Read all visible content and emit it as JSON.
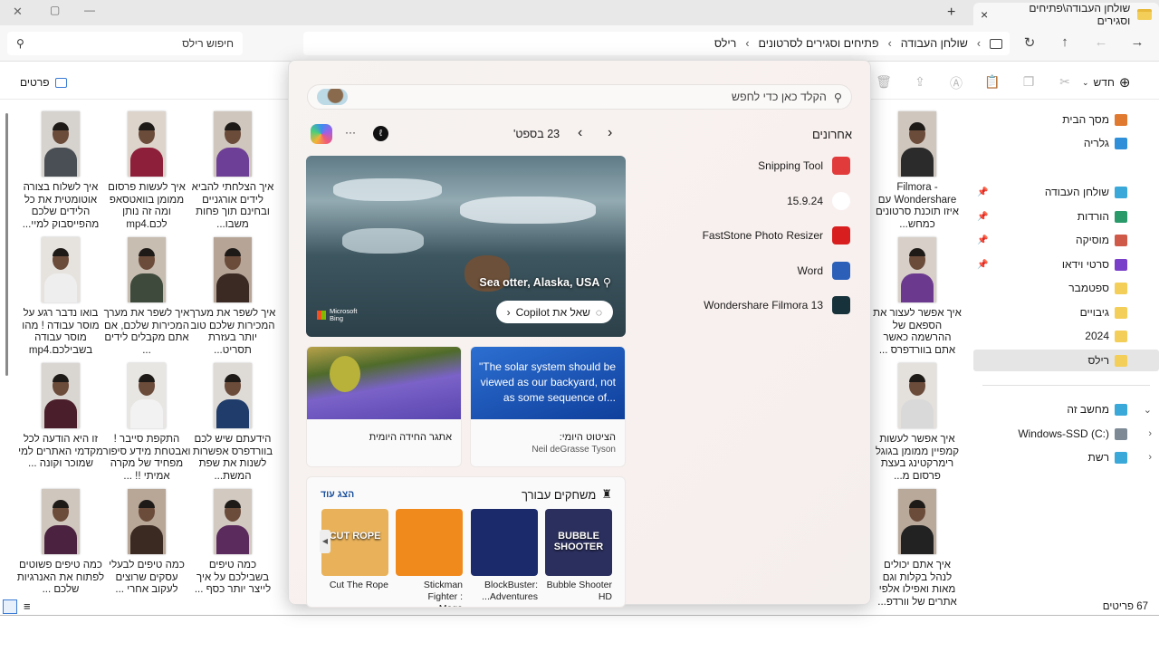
{
  "window": {
    "tab_title": "שולחן העבודה\\פתיחים וסגירים",
    "new_tab": "+",
    "close_tab": "×",
    "minimize": "—",
    "maximize": "▢",
    "close": "✕"
  },
  "address": {
    "crumbs": [
      "שולחן העבודה",
      "פתיחים וסגירים לסרטונים",
      "רילס"
    ],
    "search_placeholder": "חיפוש רילס"
  },
  "toolbar": {
    "new_label": "חדש",
    "details_label": "פרטים"
  },
  "files": [
    {
      "caption": "Filmora - Wondershare עם איזו תוכנת סרטונים כמחש...",
      "shirt": "#2b2b2b",
      "bg": "#cfc7be"
    },
    {
      "caption": "איך אפשר לעצור את הספאם של ההרשמה כאשר אתם בוורדפרס ...",
      "shirt": "#6b3a8f",
      "bg": "#d8d0c8"
    },
    {
      "caption": "איך אפשר לעשות קמפיין ממומן בגוגל רימרקטינג בעצת פרסום מ...",
      "shirt": "#d9d9d9",
      "bg": "#e4e1dd"
    },
    {
      "caption": "איך אתם יכולים לנהל בקלות וגם מאות ואפילו אלפי אתרים של וורדפ...",
      "shirt": "#222",
      "bg": "#b9a99a"
    },
    {
      "caption": "איך הצלחתי להביא לידים אורגניים ובחינם תוך פחות משבו...",
      "shirt": "#6e3f96",
      "bg": "#cfc6bd"
    },
    {
      "caption": "איך לעשות פרסום ממומן בוואטסאפ ומה זה נותן לכם.mp4",
      "shirt": "#8e1f3a",
      "bg": "#ddd5cc"
    },
    {
      "caption": "איך לשלוח בצורה אוטומטית את כל הלידים שלכם מהפייסבוק למיי...",
      "shirt": "#4a4f55",
      "bg": "#d6d3cf"
    },
    {
      "caption": "איך לשפר את מערך המכירות שלכם טוב יותר בעזרת תסריט...",
      "shirt": "#3b2a24",
      "bg": "#b6a597"
    },
    {
      "caption": "איך לשפר את מערך המכירות שלכם, אם אתם מקבלים לידים ...",
      "shirt": "#3d4a3c",
      "bg": "#c7bdb1"
    },
    {
      "caption": "בואו נדבר רגע על מוסר עבודה ! מהו מוסר עבודה בשבילכם.mp4",
      "shirt": "#eeeeee",
      "bg": "#e6e3df"
    },
    {
      "caption": "הידעתם שיש לכם בוורדפרס אפשרות לשנות את שפת המשת...",
      "shirt": "#1f3c6b",
      "bg": "#dedad6"
    },
    {
      "caption": "התקפת סייבר ! ואבטחת מידע סיפור מפחיד של מקרה אמיתי !! ...",
      "shirt": "#f2f2f2",
      "bg": "#e8e6e3"
    },
    {
      "caption": "זו היא הודעה לכל מקדמי האתרים למי שמוכר וקונה ...",
      "shirt": "#4a1e2a",
      "bg": "#d9d6d2"
    },
    {
      "caption": "כמה טיפים בשבילכם על איך לייצר יותר כסף ...",
      "shirt": "#5b2b5e",
      "bg": "#d2c9c1"
    },
    {
      "caption": "כמה טיפים לבעלי עסקים שרוצים לעקוב אחרי ...",
      "shirt": "#3a2a22",
      "bg": "#b8a797"
    },
    {
      "caption": "כמה טיפים פשוטים לפתוח את האנרגיות שלכם ...",
      "shirt": "#4b2340",
      "bg": "#cfc6bd"
    }
  ],
  "nav": [
    {
      "label": "מסך הבית",
      "color": "#e07a30"
    },
    {
      "label": "גלריה",
      "color": "#2f8fd8"
    },
    {
      "label": "שולחן העבודה",
      "color": "#3aa8d8",
      "pinned": true
    },
    {
      "label": "הורדות",
      "color": "#2b9a6a",
      "pinned": true
    },
    {
      "label": "מוסיקה",
      "color": "#d05a4a",
      "pinned": true
    },
    {
      "label": "סרטי וידאו",
      "color": "#7a3fc8",
      "pinned": true
    },
    {
      "label": "ספטמבר",
      "color": "#f3cf5a"
    },
    {
      "label": "גיבויים",
      "color": "#f3cf5a"
    },
    {
      "label": "2024",
      "color": "#f3cf5a"
    },
    {
      "label": "רילס",
      "color": "#f3cf5a",
      "selected": true
    },
    {
      "label": "מחשב זה",
      "color": "#3aa8d8",
      "expand": "⌄"
    },
    {
      "label": "Windows-SSD (C:)",
      "color": "#7d8a96",
      "expand": "‹"
    },
    {
      "label": "רשת",
      "color": "#3aa8d8",
      "expand": "‹"
    }
  ],
  "status": {
    "count": "67 פריטים"
  },
  "search_panel": {
    "placeholder": "הקלד כאן כדי לחפש",
    "recent_title": "אחרונים",
    "date": "23 בספט'",
    "more": "···",
    "recent": [
      {
        "label": "Snipping Tool",
        "color": "#e23b3b"
      },
      {
        "label": "15.9.24",
        "color": "#ffffff"
      },
      {
        "label": "FastStone Photo Resizer",
        "color": "#d81e1e"
      },
      {
        "label": "Word",
        "color": "#2b5fb8"
      },
      {
        "label": "Wondershare Filmora 13",
        "color": "#17323a"
      }
    ],
    "photo": {
      "location": "Sea otter, Alaska, USA",
      "brand_line1": "Microsoft",
      "brand_line2": "Bing",
      "copilot_button": "שאל את Copilot"
    },
    "quote_card": {
      "quote": "\"The solar system should be viewed as our backyard, not as some sequence of...",
      "title": "הציטוט היומי:",
      "author": "Neil deGrasse Tyson"
    },
    "puzzle_card": {
      "title": "אתגר החידה היומית"
    },
    "games": {
      "title": "משחקים עבורך",
      "more": "הצג עוד",
      "items": [
        {
          "name": "Bubble Shooter HD",
          "img_text": "BUBBLE SHOOTER",
          "color": "#2b2f5e"
        },
        {
          "name": "BlockBuster: Adventures...",
          "img_text": "",
          "color": "#1a2a6b"
        },
        {
          "name": "Stickman Fighter : Mega...",
          "img_text": "",
          "color": "#f08a1c"
        },
        {
          "name": "Cut The Rope",
          "img_text": "CUT ROPE",
          "color": "#e9b25a"
        }
      ]
    }
  }
}
